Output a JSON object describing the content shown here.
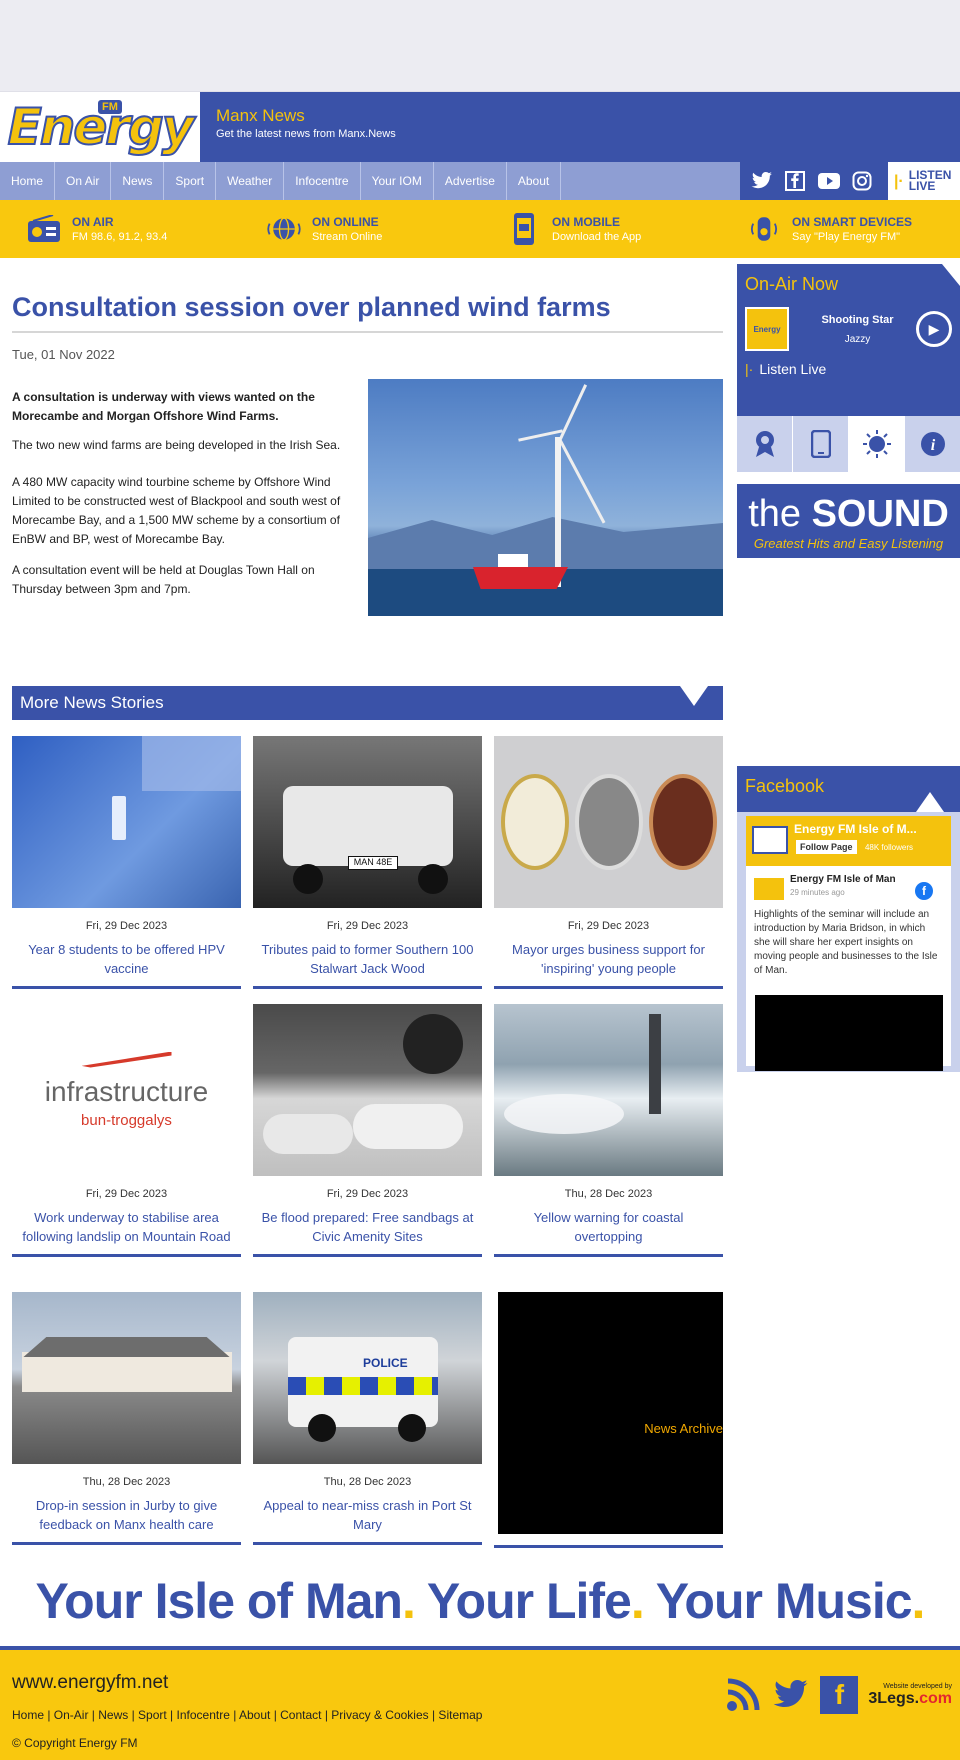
{
  "header": {
    "logo_text": "Energy",
    "logo_badge": "FM",
    "title": "Manx News",
    "subtitle": "Get the latest news from Manx.News"
  },
  "nav": {
    "items": [
      "Home",
      "On Air",
      "News",
      "Sport",
      "Weather",
      "Infocentre",
      "Your IOM",
      "Advertise",
      "About"
    ],
    "listen_top": "LISTEN",
    "listen_bottom": "LIVE"
  },
  "stations": [
    {
      "title": "ON AIR",
      "sub": "FM 98.6, 91.2, 93.4",
      "icon": "radio-icon"
    },
    {
      "title": "ON ONLINE",
      "sub": "Stream Online",
      "icon": "globe-icon"
    },
    {
      "title": "ON MOBILE",
      "sub": "Download the App",
      "icon": "mobile-icon"
    },
    {
      "title": "ON SMART DEVICES",
      "sub": "Say \"Play Energy FM\"",
      "icon": "smart-speaker-icon"
    }
  ],
  "article": {
    "title": "Consultation session over planned wind farms",
    "date": "Tue, 01 Nov 2022",
    "lead": "A consultation is underway with views wanted on the Morecambe and Morgan Offshore Wind Farms.",
    "paragraphs": [
      "The two new wind farms are being developed in the Irish Sea.",
      "A 480 MW capacity wind tourbine scheme by Offshore Wind Limited to be constructed west of Blackpool and south west of Morecambe Bay, and a 1,500 MW scheme by a consortium of EnBW and BP, west of Morecambe Bay.",
      "A consultation event will be held at Douglas Town Hall on Thursday between 3pm and 7pm."
    ]
  },
  "more_news": {
    "heading": "More News Stories",
    "archive": "News Archive",
    "stories": [
      {
        "date": "Fri, 29 Dec 2023",
        "title": "Year 8 students to be offered HPV vaccine"
      },
      {
        "date": "Fri, 29 Dec 2023",
        "title": "Tributes paid to former Southern 100 Stalwart Jack Wood"
      },
      {
        "date": "Fri, 29 Dec 2023",
        "title": "Mayor urges business support for 'inspiring' young people"
      },
      {
        "date": "Fri, 29 Dec 2023",
        "title": "Work underway to stabilise area following landslip on Mountain Road"
      },
      {
        "date": "Fri, 29 Dec 2023",
        "title": "Be flood prepared: Free sandbags at Civic Amenity Sites"
      },
      {
        "date": "Thu, 28 Dec 2023",
        "title": "Yellow warning for coastal overtopping"
      },
      {
        "date": "Thu, 28 Dec 2023",
        "title": "Drop-in session in Jurby to give feedback on Manx health care"
      },
      {
        "date": "Thu, 28 Dec 2023",
        "title": "Appeal to near-miss crash in Port St Mary"
      }
    ],
    "thumb_texts": {
      "infra_word": "infrastructure",
      "infra_sub": "bun-troggalys",
      "plate": "MAN 48E",
      "police": "POLICE"
    }
  },
  "sidebar": {
    "onair_title": "On-Air Now",
    "track_name": "Shooting Star",
    "track_artist": "Jazzy",
    "listen_live": "Listen Live",
    "sound_the": "the ",
    "sound_word": "SOUND",
    "sound_tag": "Greatest Hits and Easy Listening",
    "facebook_title": "Facebook",
    "fb_page": "Energy FM Isle of M...",
    "fb_follow": "Follow Page",
    "fb_followers": "48K followers",
    "fb_author": "Energy FM Isle of Man",
    "fb_ago": "29 minutes ago",
    "fb_text": "Highlights of the seminar will include an introduction by Maria Bridson, in which she will share her expert insights on moving people and businesses to the Isle of Man."
  },
  "slogan": {
    "part1": "Your Isle of Man",
    "part2": "Your Life",
    "part3": "Your Music",
    "dot": "."
  },
  "footer": {
    "url": "www.energyfm.net",
    "links": "Home | On-Air | News | Sport | Infocentre | About | Contact | Privacy & Cookies | Sitemap",
    "copyright": "© Copyright Energy FM",
    "dev_small": "Website developed by",
    "dev_name": "3Legs.",
    "dev_name_red": "com"
  },
  "colors": {
    "brand_blue": "#3a52a8",
    "brand_yellow": "#f9c80e",
    "nav_blue": "#8e9ed3"
  }
}
